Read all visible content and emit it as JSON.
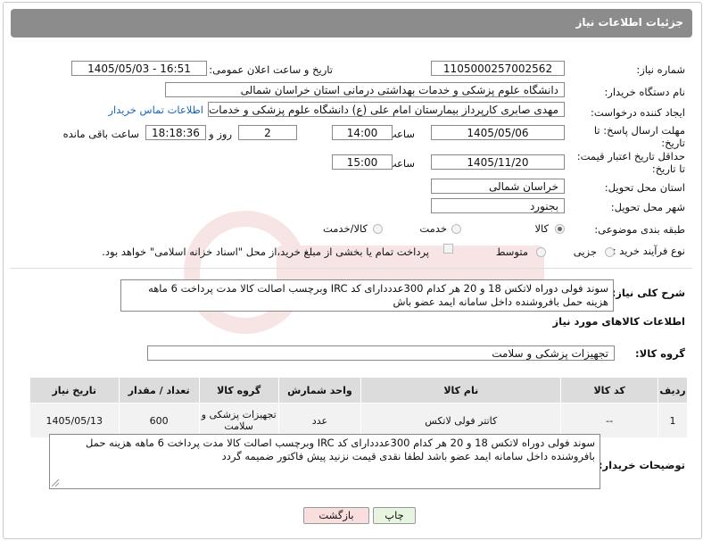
{
  "header": {
    "title": "جزئیات اطلاعات نیاز"
  },
  "fields": {
    "need_number_label": "شماره نیاز:",
    "need_number": "1105000257002562",
    "announce_label": "تاریخ و ساعت اعلان عمومی:",
    "announce_value": "1405/05/03 - 16:51",
    "buyer_org_label": "نام دستگاه خریدار:",
    "buyer_org": "دانشگاه علوم پزشکی و خدمات بهداشتی درمانی استان خراسان شمالی",
    "creator_label": "ایجاد کننده درخواست:",
    "creator": "مهدی صابری کارپرداز بیمارستان امام علی (ع) دانشگاه علوم پزشکی و خدمات بهداشتی",
    "contact_link": "اطلاعات تماس خریدار",
    "deadline_label": "مهلت ارسال پاسخ: تا تاریخ:",
    "deadline_date": "1405/05/06",
    "time_label": "ساعت",
    "deadline_time": "14:00",
    "days_value": "2",
    "days_label": "روز و",
    "remaining_time": "18:18:36",
    "remaining_label": "ساعت باقی مانده",
    "validity_label": "حداقل تاریخ اعتبار قیمت: تا تاریخ:",
    "validity_date": "1405/11/20",
    "validity_time": "15:00",
    "province_label": "استان محل تحویل:",
    "province": "خراسان شمالی",
    "city_label": "شهر محل تحویل:",
    "city": "بجنورد",
    "category_label": "طبقه بندی موضوعی:",
    "category_options": [
      "کالا",
      "خدمت",
      "کالا/خدمت"
    ],
    "process_label": "نوع فرآیند خرید :",
    "process_options": [
      "جزیی",
      "متوسط"
    ],
    "payment_note": "پرداخت تمام یا بخشی از مبلغ خرید،از محل \"اسناد خزانه اسلامی\" خواهد بود."
  },
  "description": {
    "label": "شرح کلی نیاز:",
    "text": "سوند فولی دوراه لاتکس 18  و 20 هر کدام 300عدددارای  کد IRC وبرچسب اصالت کالا مدت پرداخت 6 ماهه هزینه حمل بافروشنده داخل سامانه ایمد عضو باش"
  },
  "goods": {
    "section_title": "اطلاعات کالاهای مورد نیاز",
    "group_label": "گروه کالا:",
    "group_value": "تجهیزات پزشکی و سلامت",
    "columns": [
      "ردیف",
      "کد کالا",
      "نام کالا",
      "واحد شمارش",
      "گروه کالا",
      "تعداد / مقدار",
      "تاریخ نیاز"
    ],
    "rows": [
      [
        "1",
        "--",
        "کاتتر فولی لاتکس",
        "عدد",
        "تجهیزات پزشکی و سلامت",
        "600",
        "1405/05/13"
      ]
    ]
  },
  "buyer_notes": {
    "label": "توضیحات خریدار:",
    "text": "سوند فولی دوراه لاتکس 18  و 20 هر کدام 300عدددارای  کد IRC وبرچسب اصالت کالا مدت پرداخت 6 ماهه هزینه حمل بافروشنده داخل سامانه ایمد عضو باشد لطفا نقدی قیمت نزنید  پیش فاکتور ضمیمه گردد"
  },
  "buttons": {
    "print": "چاپ",
    "back": "بازگشت"
  },
  "colors": {
    "header_bg": "#8c8c8c",
    "back_btn_bg": "#f9dede",
    "print_btn_bg": "#e6f4e0",
    "link": "#1565c0"
  }
}
